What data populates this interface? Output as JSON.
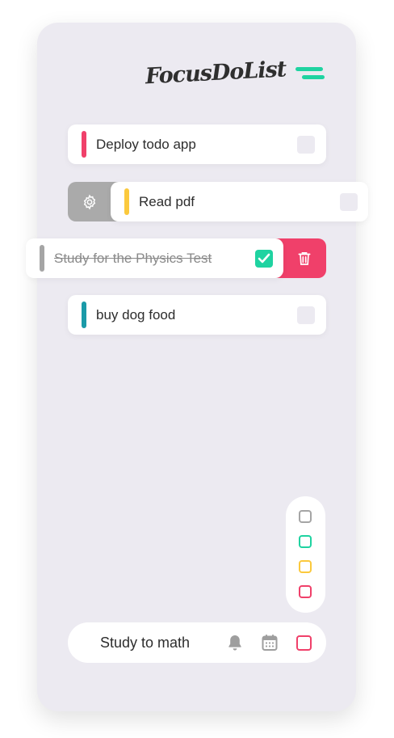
{
  "app": {
    "title": "FocusDoList",
    "accent_color": "#1fd3a1"
  },
  "header": {
    "menu_icon": "menu-icon"
  },
  "tasks": [
    {
      "label": "Deploy todo app",
      "color": "#f0406a",
      "done": false
    },
    {
      "label": "Read pdf",
      "color": "#fbc93d",
      "done": false,
      "swiped": "right",
      "revealed_icon": "gear-icon"
    },
    {
      "label": "Study for the Physics Test",
      "color": "#a5a5a5",
      "done": true,
      "swiped": "left",
      "revealed_icon": "trash-icon"
    },
    {
      "label": "buy dog food",
      "color": "#1a9aa8",
      "done": false
    }
  ],
  "color_filter": {
    "options": [
      {
        "name": "gray",
        "color": "#a5a5a5"
      },
      {
        "name": "green",
        "color": "#1fd3a1"
      },
      {
        "name": "yellow",
        "color": "#fbc93d"
      },
      {
        "name": "red",
        "color": "#f0406a"
      }
    ]
  },
  "new_task": {
    "value": "Study to math",
    "bell_icon": "bell-icon",
    "calendar_icon": "calendar-icon",
    "selected_color": "#f0406a"
  }
}
